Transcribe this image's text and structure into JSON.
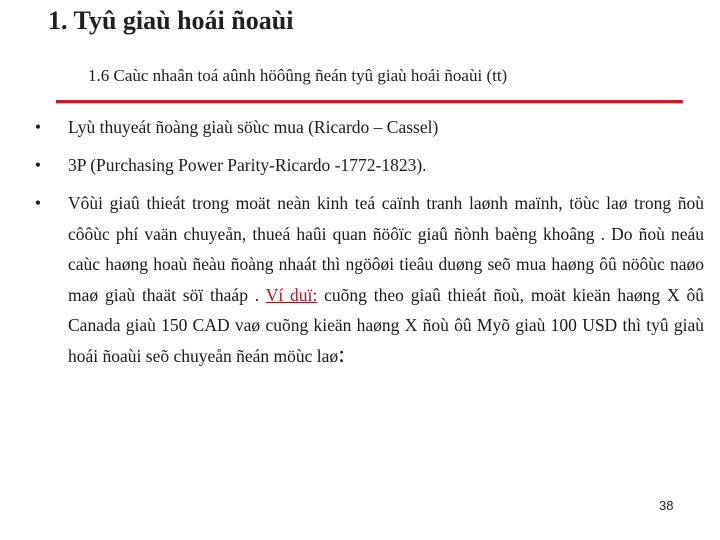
{
  "title": "1. Tyû giaù hoái ñoaùi",
  "subtitle": "1.6 Caùc nhaân toá aûnh höôûng ñeán tyû giaù hoái ñoaùi (tt)",
  "bullets": [
    {
      "text": "Lyù thuyeát ñoàng giaù söùc mua (Ricardo – Cassel)"
    },
    {
      "text": "3P (Purchasing Power Parity-Ricardo -1772-1823)."
    },
    {
      "text_before": "Vôùi giaû thieát trong moät neàn kinh teá caïnh tranh laønh maïnh, töùc laø trong ñoù côôùc phí vaän chuyeån, thueá haûi quan ñöôïc giaû ñònh baèng khoâng . Do ñoù neáu caùc haøng hoaù ñeàu ñoàng nhaát thì ngöôøi tieâu duøng seõ mua haøng ôû nöôùc naøo maø giaù thaät söï thaáp .",
      "example_label": "Ví duï:",
      "text_after": "cuõng theo giaû thieát ñoù, moät kieän haøng X ôû Canada giaù 150 CAD vaø cuõng kieän haøng X ñoù ôû Myõ giaù 100 USD thì tyû giaù hoái ñoaùi seõ chuyeån ñeán möùc laø",
      "trailing_colon": ":"
    }
  ],
  "bullet_symbol": "•",
  "page_number": "38",
  "colors": {
    "rule": "#c0202c",
    "example_link": "#b0111a"
  }
}
